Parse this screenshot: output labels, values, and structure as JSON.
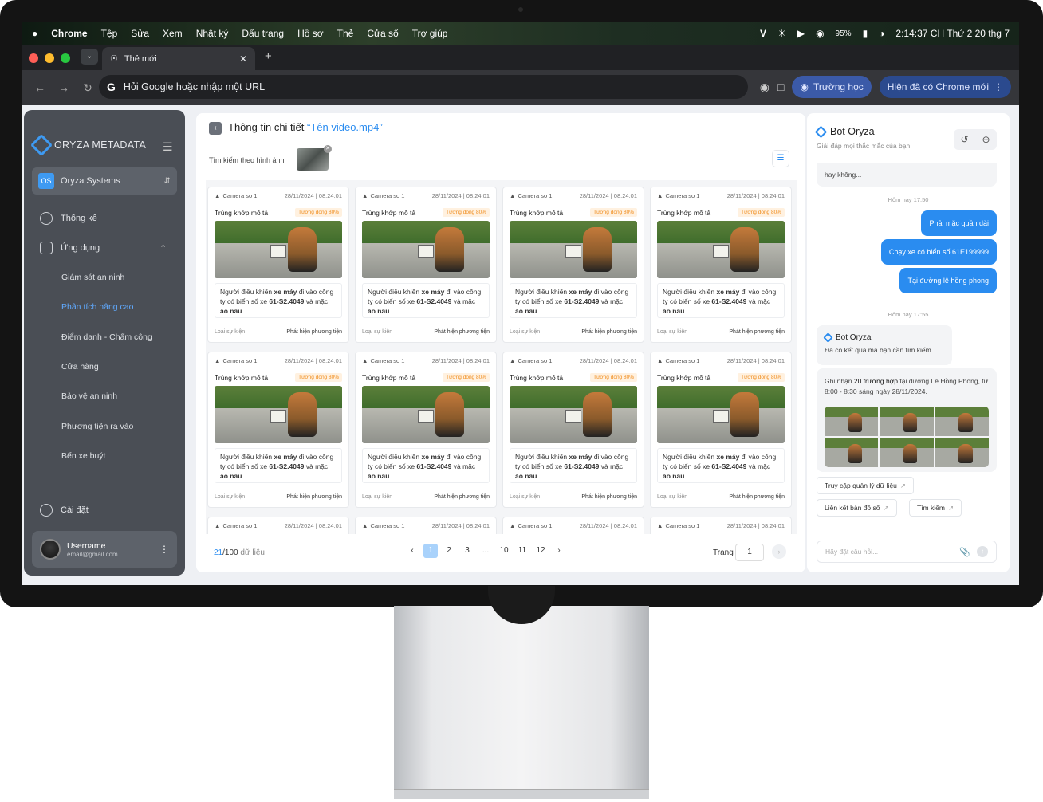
{
  "menubar": {
    "apple": "",
    "app": "Chrome",
    "items": [
      "Tệp",
      "Sửa",
      "Xem",
      "Nhật ký",
      "Dấu trang",
      "Hồ sơ",
      "Thẻ",
      "Cửa sổ",
      "Trợ giúp"
    ],
    "v": "V",
    "battery": "95%",
    "clock": "2:14:37 CH Thứ 2 20 thg 7"
  },
  "browser": {
    "tab_title": "Thẻ mới",
    "omnibox_g": "G",
    "omnibox_placeholder": "Hỏi Google hoặc nhập một URL",
    "profile": "Trường học",
    "update": "Hiện đã có Chrome mới"
  },
  "sidebar": {
    "brand": "ORYZA METADATA",
    "org_badge": "OS",
    "org": "Oryza Systems",
    "stats": "Thống kê",
    "apps": "Ứng dụng",
    "subitems": [
      "Giám sát an ninh",
      "Phân tích nâng cao",
      "Điểm danh - Chấm công",
      "Cửa hàng",
      "Bảo vệ an ninh",
      "Phương tiện ra vào",
      "Bến xe buýt"
    ],
    "settings": "Cài đặt",
    "username": "Username",
    "email": "email@gmail.com"
  },
  "main": {
    "title": "Thông tin chi tiết ",
    "title_file": "“Tên video.mp4”",
    "search_label": "Tìm kiếm theo hình ảnh",
    "card": {
      "camera": "Camera so 1",
      "time": "28/11/2024 | 08:24:01",
      "match": "Trùng khớp mô tả",
      "similarity": "Tương đồng 80%",
      "desc_a": "Người điều khiển ",
      "desc_b": "xe máy",
      "desc_c": " đi vào công ty có biển số xe ",
      "desc_d": "61-S2.4049",
      "desc_e": " và mặc ",
      "desc_f": "áo nâu",
      "desc_g": ".",
      "event_label": "Loại sự kiện",
      "event_value": "Phát hiện phương tiện"
    },
    "pager": {
      "count": "21",
      "total": "/100",
      "unit": " dữ liệu",
      "pages": [
        "1",
        "2",
        "3",
        "...",
        "10",
        "11",
        "12"
      ],
      "goto_label": "Trang",
      "goto_value": "1"
    }
  },
  "chat": {
    "bot_name": "Bot Oryza",
    "bot_sub": "Giải đáp mọi thắc mắc của bạn",
    "prev_msg": "hay không...",
    "time1": "Hôm nay 17:50",
    "user_msgs": [
      "Phải mặc quần dài",
      "Chạy xe có biển số 61E199999",
      "Tại đường lê hồng phong"
    ],
    "time2": "Hôm nay 17:55",
    "bot_reply": "Đã có kết quả mà bạn cần tìm kiếm.",
    "result_a": "Ghi nhận ",
    "result_b": "20 trường hợp",
    "result_c": " tại đường Lê Hồng Phong, từ 8:00 - 8:30 sáng ngày 28/11/2024.",
    "links": [
      "Truy cập quản lý dữ liệu",
      "Liên kết bản đồ số",
      "Tìm kiếm"
    ],
    "input_placeholder": "Hãy đặt câu hỏi..."
  }
}
